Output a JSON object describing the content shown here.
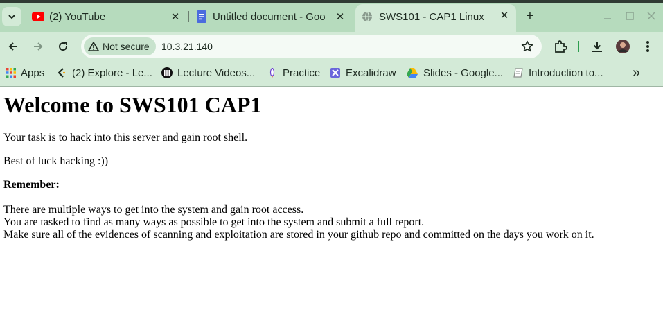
{
  "browser": {
    "tabs": [
      {
        "title": "(2) YouTube",
        "icon": "youtube-icon",
        "active": false
      },
      {
        "title": "Untitled document - Goo",
        "icon": "google-docs-icon",
        "active": false
      },
      {
        "title": "SWS101 - CAP1 Linux",
        "icon": "globe-icon",
        "active": true
      }
    ],
    "new_tab_label": "+",
    "address_bar": {
      "security_label": "Not secure",
      "url": "10.3.21.140"
    },
    "bookmarks": [
      {
        "label": "Apps",
        "icon": "apps-grid-icon"
      },
      {
        "label": "(2) Explore - Le...",
        "icon": "explore-icon"
      },
      {
        "label": "Lecture Videos...",
        "icon": "lecture-icon"
      },
      {
        "label": "Practice",
        "icon": "practice-icon"
      },
      {
        "label": "Excalidraw",
        "icon": "excalidraw-icon"
      },
      {
        "label": "Slides - Google...",
        "icon": "google-drive-icon"
      },
      {
        "label": "Introduction to...",
        "icon": "notebook-icon"
      }
    ],
    "more_bookmarks": "»",
    "colors": {
      "accent": "#d3ead7",
      "tabstrip": "#b6dbbd",
      "extensions_separator": "#2e9e4f"
    }
  },
  "page": {
    "heading": "Welcome to SWS101 CAP1",
    "intro": "Your task is to hack into this server and gain root shell.",
    "luck": "Best of luck hacking :))",
    "remember_label": "Remember:",
    "notes": [
      "There are multiple ways to get into the system and gain root access.",
      "You are tasked to find as many ways as possible to get into the system and submit a full report.",
      "Make sure all of the evidences of scanning and exploitation are stored in your github repo and committed on the days you work on it."
    ]
  }
}
